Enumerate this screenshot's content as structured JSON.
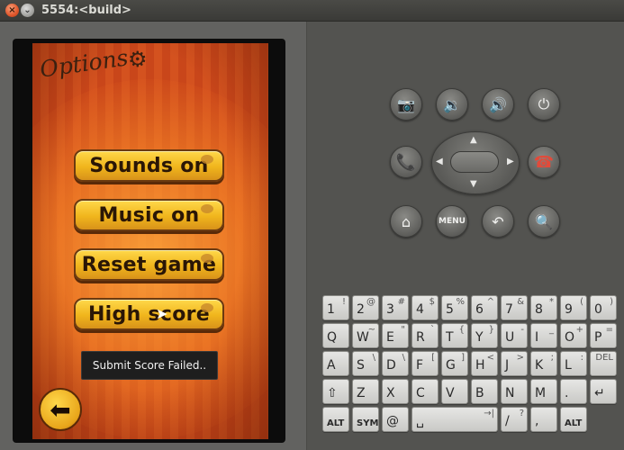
{
  "window": {
    "title": "5554:<build>",
    "close_glyph": "×",
    "minimize_glyph": "⌄"
  },
  "game": {
    "options_title": "Options",
    "gear_icon": "gear-icon",
    "gear_glyph": "⚙",
    "buttons": [
      {
        "label": "Sounds on"
      },
      {
        "label": "Music on"
      },
      {
        "label": "Reset game"
      },
      {
        "label": "High score"
      }
    ],
    "toast": "Submit Score Failed..",
    "back_glyph": "⬅"
  },
  "hardware": {
    "camera_glyph": "📷",
    "vol_down_glyph": "🔉",
    "vol_up_glyph": "🔊",
    "power_glyph": "⏻",
    "call_glyph": "📞",
    "end_glyph": "☎",
    "home_glyph": "⌂",
    "menu_label": "MENU",
    "back_glyph": "↶",
    "search_glyph": "🔍",
    "dpad_up": "▲",
    "dpad_down": "▼",
    "dpad_left": "◀",
    "dpad_right": "▶"
  },
  "keyboard": {
    "rows": [
      [
        {
          "main": "1",
          "alt": "!"
        },
        {
          "main": "2",
          "alt": "@"
        },
        {
          "main": "3",
          "alt": "#"
        },
        {
          "main": "4",
          "alt": "$"
        },
        {
          "main": "5",
          "alt": "%"
        },
        {
          "main": "6",
          "alt": "^"
        },
        {
          "main": "7",
          "alt": "&"
        },
        {
          "main": "8",
          "alt": "*"
        },
        {
          "main": "9",
          "alt": "("
        },
        {
          "main": "0",
          "alt": ")"
        }
      ],
      [
        {
          "main": "Q",
          "alt": ""
        },
        {
          "main": "W",
          "alt": "~"
        },
        {
          "main": "E",
          "alt": "\""
        },
        {
          "main": "R",
          "alt": "`"
        },
        {
          "main": "T",
          "alt": "{"
        },
        {
          "main": "Y",
          "alt": "}"
        },
        {
          "main": "U",
          "alt": "-"
        },
        {
          "main": "I",
          "alt": "_"
        },
        {
          "main": "O",
          "alt": "+"
        },
        {
          "main": "P",
          "alt": "="
        }
      ],
      [
        {
          "main": "A",
          "alt": ""
        },
        {
          "main": "S",
          "alt": "\\"
        },
        {
          "main": "D",
          "alt": "\\"
        },
        {
          "main": "F",
          "alt": "["
        },
        {
          "main": "G",
          "alt": "]"
        },
        {
          "main": "H",
          "alt": "<"
        },
        {
          "main": "J",
          "alt": ">"
        },
        {
          "main": "K",
          "alt": ";"
        },
        {
          "main": "L",
          "alt": ":"
        },
        {
          "main": "",
          "alt": "DEL"
        }
      ],
      [
        {
          "main": "⇧",
          "alt": ""
        },
        {
          "main": "Z",
          "alt": ""
        },
        {
          "main": "X",
          "alt": ""
        },
        {
          "main": "C",
          "alt": ""
        },
        {
          "main": "V",
          "alt": ""
        },
        {
          "main": "B",
          "alt": ""
        },
        {
          "main": "N",
          "alt": ""
        },
        {
          "main": "M",
          "alt": ""
        },
        {
          "main": ".",
          "alt": ""
        },
        {
          "main": "↵",
          "alt": ""
        }
      ],
      [
        {
          "main": "ALT",
          "alt": ""
        },
        {
          "main": "SYM",
          "alt": ""
        },
        {
          "main": "@",
          "alt": ""
        },
        {
          "main": "␣",
          "alt": "→|"
        },
        {
          "main": "/",
          "alt": "?"
        },
        {
          "main": ",",
          "alt": ""
        },
        {
          "main": "ALT",
          "alt": ""
        }
      ]
    ]
  }
}
